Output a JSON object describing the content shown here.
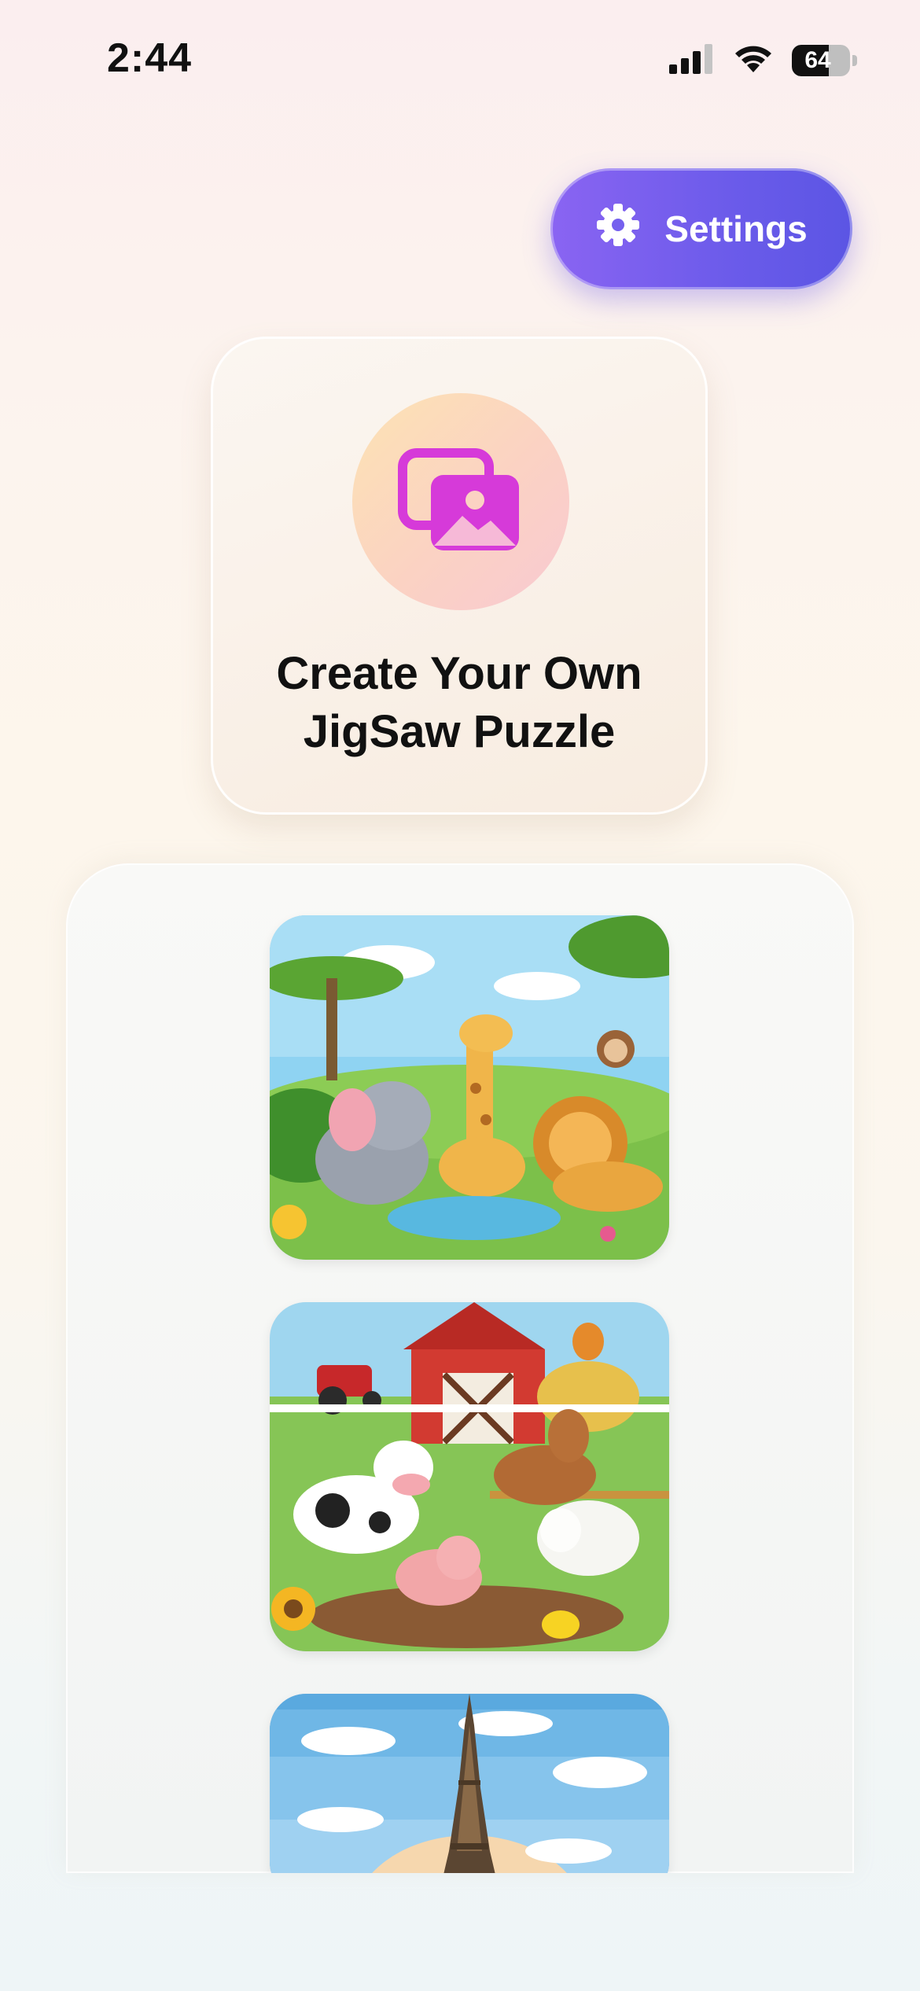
{
  "status_bar": {
    "time": "2:44",
    "battery_level": "64",
    "icons": [
      "cellular-signal-icon",
      "wifi-icon",
      "battery-icon"
    ]
  },
  "header": {
    "settings_label": "Settings",
    "settings_icon": "gear-icon"
  },
  "create_card": {
    "title_line1": "Create Your Own",
    "title_line2": "JigSaw Puzzle",
    "icon": "photos-icon"
  },
  "puzzles": [
    {
      "theme": "safari-animals-image"
    },
    {
      "theme": "farm-animals-image"
    },
    {
      "theme": "eiffel-tower-image"
    }
  ],
  "colors": {
    "settings_button": "#6b5bea",
    "create_icon": "#d63ad9",
    "text": "#111111"
  }
}
